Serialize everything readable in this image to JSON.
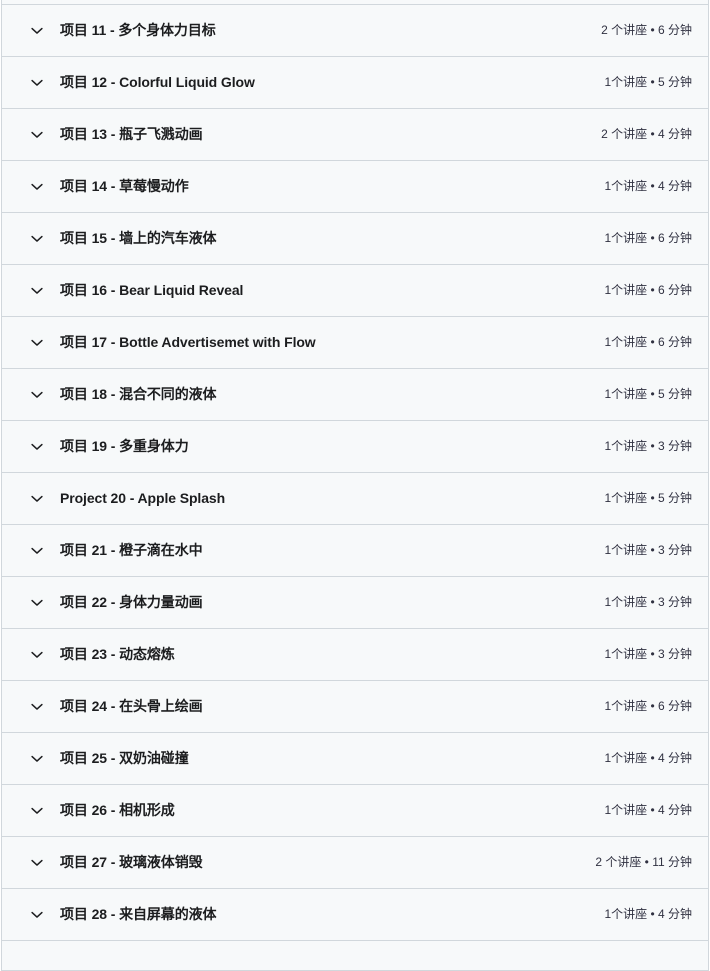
{
  "curriculum": {
    "icons": {
      "chevron": "chevron-down-icon"
    },
    "colors": {
      "row_background": "#f7f9fa",
      "border": "#d1d7dc",
      "title_text": "#1c1d1f",
      "meta_text": "#303141",
      "page_background": "#ffffff"
    },
    "sections": [
      {
        "title": "项目 11 - 多个身体力目标",
        "meta": "2 个讲座 • 6 分钟"
      },
      {
        "title": "项目 12 - Colorful Liquid Glow",
        "meta": "1个讲座 • 5 分钟"
      },
      {
        "title": "项目 13 - 瓶子飞溅动画",
        "meta": "2 个讲座 • 4 分钟"
      },
      {
        "title": "项目 14 - 草莓慢动作",
        "meta": "1个讲座 • 4 分钟"
      },
      {
        "title": "项目 15 - 墙上的汽车液体",
        "meta": "1个讲座 • 6 分钟"
      },
      {
        "title": "项目 16 - Bear Liquid Reveal",
        "meta": "1个讲座 • 6 分钟"
      },
      {
        "title": "项目 17 - Bottle Advertisemet with Flow",
        "meta": "1个讲座 • 6 分钟"
      },
      {
        "title": "项目 18 - 混合不同的液体",
        "meta": "1个讲座 • 5 分钟"
      },
      {
        "title": "项目 19 - 多重身体力",
        "meta": "1个讲座 • 3 分钟"
      },
      {
        "title": "Project 20 - Apple Splash",
        "meta": "1个讲座 • 5 分钟"
      },
      {
        "title": "项目 21 - 橙子滴在水中",
        "meta": "1个讲座 • 3 分钟"
      },
      {
        "title": "项目 22 - 身体力量动画",
        "meta": "1个讲座 • 3 分钟"
      },
      {
        "title": "项目 23 - 动态熔炼",
        "meta": "1个讲座 • 3 分钟"
      },
      {
        "title": "项目 24 - 在头骨上绘画",
        "meta": "1个讲座 • 6 分钟"
      },
      {
        "title": "项目 25 - 双奶油碰撞",
        "meta": "1个讲座 • 4 分钟"
      },
      {
        "title": "项目 26 - 相机形成",
        "meta": "1个讲座 • 4 分钟"
      },
      {
        "title": "项目 27 - 玻璃液体销毁",
        "meta": "2 个讲座 • 11 分钟"
      },
      {
        "title": "项目 28 - 来自屏幕的液体",
        "meta": "1个讲座 • 4 分钟"
      }
    ]
  }
}
